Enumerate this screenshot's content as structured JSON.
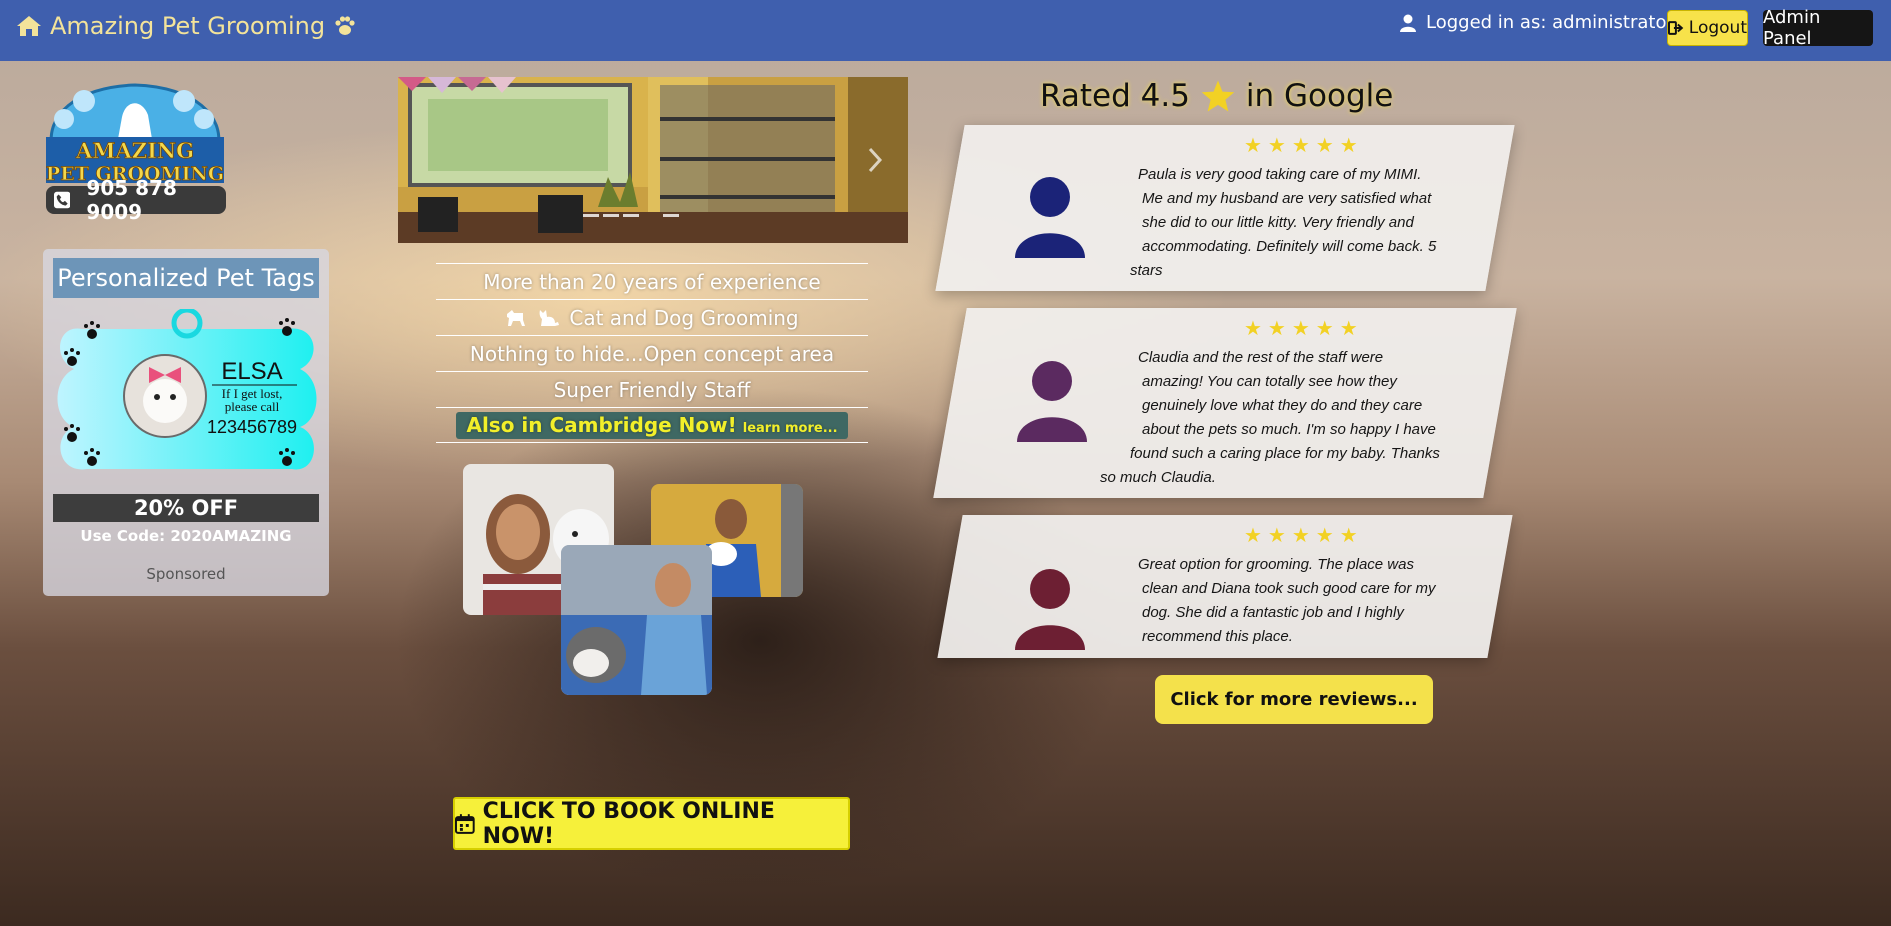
{
  "navbar": {
    "brand_name": "Amazing Pet Grooming",
    "logged_in_text": "Logged in as: administrator",
    "logout_label": "Logout",
    "admin_label": "Admin Panel"
  },
  "logo": {
    "line1": "AMAZING",
    "line2": "PET GROOMING"
  },
  "contact": {
    "phone": "905 878 9009"
  },
  "ad": {
    "title": "Personalized Pet Tags",
    "tag_name": "ELSA",
    "tag_line1": "If I get lost,",
    "tag_line2": "please call",
    "tag_number": "123456789",
    "discount": "20% OFF",
    "code_text": "Use Code: 2020AMAZING",
    "sponsored": "Sponsored"
  },
  "features": {
    "items": [
      "More than 20 years of experience",
      "Cat and Dog Grooming",
      "Nothing to hide...Open concept area",
      "Super Friendly Staff"
    ],
    "cambridge_main": "Also in Cambridge Now!",
    "cambridge_more": "learn more..."
  },
  "book_button": "CLICK TO BOOK ONLINE NOW!",
  "reviews": {
    "rated_prefix": "Rated 4.5",
    "rated_suffix": "in Google",
    "items": [
      {
        "lines": [
          "Paula is very good taking care of my MIMI.",
          "Me and my husband are very satisfied what",
          "she did to our little kitty. Very friendly and",
          "accommodating. Definitely will come back. 5",
          "stars"
        ],
        "avatar_color": "#1b2378"
      },
      {
        "lines": [
          "Claudia and the rest of the staff were",
          "amazing! You can totally see how they",
          "genuinely love what they do and they care",
          "about the pets so much. I'm so happy I have",
          "found such a caring place for my baby. Thanks",
          "so much Claudia."
        ],
        "avatar_color": "#5b2a60"
      },
      {
        "lines": [
          "Great option for grooming. The place was",
          "clean and Diana took such good care for my",
          "dog. She did a fantastic job and I highly",
          "recommend this place."
        ],
        "avatar_color": "#6d1f33"
      }
    ],
    "more_label": "Click for more reviews..."
  },
  "colors": {
    "navbar": "#3f5fae",
    "accent_yellow": "#f6f03a",
    "brand_text": "#f3e39a"
  }
}
